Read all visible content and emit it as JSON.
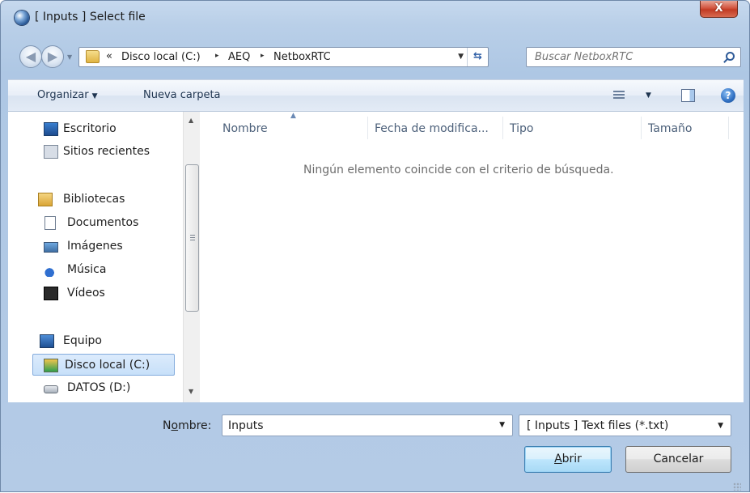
{
  "window": {
    "title": "[ Inputs ] Select file",
    "close_label": "X"
  },
  "navigation": {
    "back_label": "◀",
    "forward_label": "▶",
    "breadcrumb_prefix": "«",
    "breadcrumbs": [
      "Disco local (C:)",
      "AEQ",
      "NetboxRTC"
    ],
    "separator": "▸",
    "search_placeholder": "Buscar NetboxRTC",
    "refresh_label": "⇆"
  },
  "toolbar": {
    "organize_label": "Organizar",
    "new_folder_label": "Nueva carpeta",
    "help_label": "?"
  },
  "sidebar": {
    "items": [
      {
        "label": "Escritorio",
        "icon": "desktop-icon"
      },
      {
        "label": "Sitios recientes",
        "icon": "recent-places-icon"
      },
      {
        "label": "Bibliotecas",
        "icon": "libraries-icon"
      },
      {
        "label": "Documentos",
        "icon": "documents-icon"
      },
      {
        "label": "Imágenes",
        "icon": "images-icon"
      },
      {
        "label": "Música",
        "icon": "music-icon"
      },
      {
        "label": "Vídeos",
        "icon": "videos-icon"
      },
      {
        "label": "Equipo",
        "icon": "computer-icon"
      },
      {
        "label": "Disco local (C:)",
        "icon": "local-disk-icon",
        "selected": true
      },
      {
        "label": "DATOS (D:)",
        "icon": "drive-icon"
      }
    ]
  },
  "file_list": {
    "columns": [
      "Nombre",
      "Fecha de modifica...",
      "Tipo",
      "Tamaño"
    ],
    "empty_message": "Ningún elemento coincide con el criterio de búsqueda."
  },
  "bottom": {
    "name_label_prefix": "N",
    "name_label_underlined": "o",
    "name_label_suffix": "mbre:",
    "name_value": "Inputs",
    "file_type": "[ Inputs ] Text files (*.txt)",
    "open_label_underlined": "A",
    "open_label_rest": "brir",
    "cancel_label": "Cancelar"
  }
}
